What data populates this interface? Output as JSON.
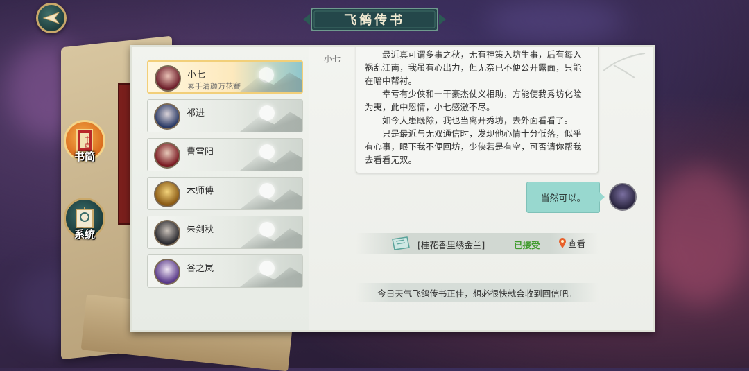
{
  "window": {
    "title": "飞鸽传书"
  },
  "nav": {
    "letters": {
      "label": "书简",
      "seal_text": "书启"
    },
    "system": {
      "label": "系统"
    }
  },
  "contacts": [
    {
      "name": "小七",
      "subtitle": "素手清颜万花賽",
      "active": true
    },
    {
      "name": "祁进",
      "subtitle": ""
    },
    {
      "name": "曹雪阳",
      "subtitle": ""
    },
    {
      "name": "木师傅",
      "subtitle": ""
    },
    {
      "name": "朱剑秋",
      "subtitle": ""
    },
    {
      "name": "谷之岚",
      "subtitle": ""
    }
  ],
  "chat": {
    "sender": "小七",
    "paragraphs": [
      "最近真可谓多事之秋，无有神策入坊生事，后有每入祸乱江南，我虽有心出力，但无奈已不便公开露面，只能在暗中帮衬。",
      "幸亏有少侠和一干豪杰仗义相助，方能使我秀坊化险为夷，此中恩情，小七感激不尽。",
      "如今大患既除，我也当离开秀坊，去外面看看了。",
      "只是最近与无双通信时，发现他心情十分低落，似乎有心事，眼下我不便回坊，少侠若是有空，可否请你帮我去看看无双。"
    ],
    "reply": "当然可以。",
    "quest": {
      "name": "[桂花香里绣金兰]",
      "status": "已接受",
      "view_label": "查看"
    },
    "system_message": "今日天气飞鸽传书正佳，想必很快就会收到回信吧。"
  },
  "colors": {
    "accent_teal": "#98d8cf",
    "accepted_green": "#3f9b2d",
    "active_border": "#f2cf79"
  }
}
